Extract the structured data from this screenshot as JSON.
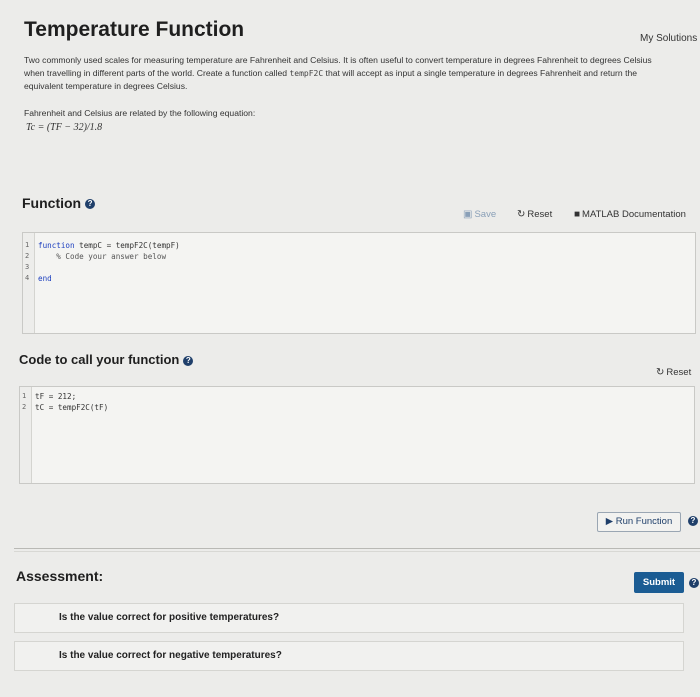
{
  "header": {
    "title": "Temperature Function",
    "my_solutions": "My Solutions"
  },
  "description": {
    "part1": "Two commonly used scales for measuring temperature are Fahrenheit and Celsius. It is often useful to convert temperature in degrees Fahrenheit to degrees Celsius when travelling in different parts of the world. Create a function called ",
    "func_name": "tempF2C",
    "part2": " that will accept as input a single temperature in degrees Fahrenheit and return the equivalent temperature in degrees Celsius.",
    "relation": "Fahrenheit and Celsius are related by the following equation:",
    "equation": "Tc = (TF − 32)/1.8"
  },
  "function_section": {
    "title": "Function",
    "save_label": "Save",
    "reset_label": "Reset",
    "docs_label": "MATLAB Documentation",
    "lines": [
      {
        "num": "1",
        "kw": "function",
        "rest": " tempC = tempF2C(tempF)"
      },
      {
        "num": "2",
        "comment": "    % Code your answer below"
      },
      {
        "num": "3"
      },
      {
        "num": "4",
        "kw": "end"
      }
    ]
  },
  "call_section": {
    "title": "Code to call your function",
    "reset_label": "Reset",
    "lines": [
      {
        "num": "1",
        "text": "tF = 212;"
      },
      {
        "num": "2",
        "text": "tC = tempF2C(tF)"
      }
    ],
    "run_label": "Run Function"
  },
  "assessment": {
    "title": "Assessment:",
    "submit_label": "Submit",
    "items": [
      "Is the value correct for positive temperatures?",
      "Is the value correct for negative temperatures?"
    ]
  },
  "colors": {
    "accent": "#1b5c93",
    "keyword": "#1d3fbf"
  },
  "icons": {
    "save": "save-icon",
    "reset": "reset-icon",
    "docs": "book-icon",
    "run": "play-icon",
    "help": "help-icon"
  }
}
